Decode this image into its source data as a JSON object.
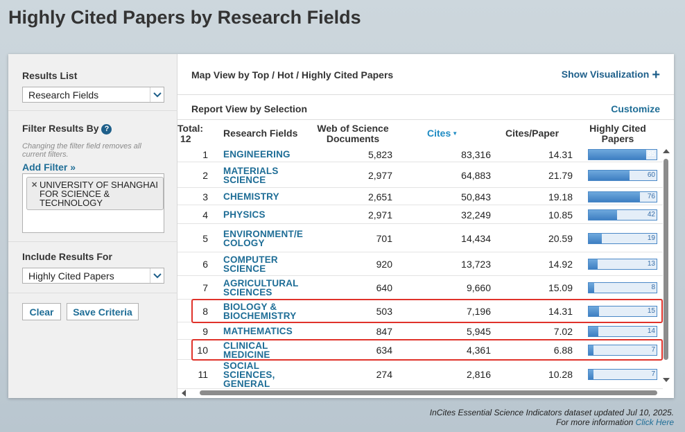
{
  "page_title": "Highly Cited Papers by Research Fields",
  "sidebar": {
    "results_list_heading": "Results List",
    "results_list_value": "Research Fields",
    "filter_heading": "Filter Results By",
    "filter_help": "?",
    "filter_hint": "Changing the filter field removes all current filters.",
    "add_filter": "Add Filter »",
    "filter_chip": "UNIVERSITY OF SHANGHAI FOR SCIENCE & TECHNOLOGY",
    "include_heading": "Include Results For",
    "include_value": "Highly Cited Papers",
    "clear_button": "Clear",
    "save_button": "Save Criteria"
  },
  "main": {
    "map_title": "Map View by Top / Hot / Highly Cited Papers",
    "show_visualization": "Show Visualization",
    "report_title": "Report View by Selection",
    "customize": "Customize"
  },
  "table": {
    "headers": {
      "total": "Total:",
      "total_count": "12",
      "field": "Research Fields",
      "docs": "Web of Science Documents",
      "cites": "Cites",
      "cites_per_paper": "Cites/Paper",
      "highly_cited": "Highly Cited Papers"
    },
    "rows": [
      {
        "rank": "1",
        "field": "ENGINEERING",
        "docs": "5,823",
        "cites": "83,316",
        "cpp": "14.31",
        "hcp": "85",
        "hcp_value": 85
      },
      {
        "rank": "2",
        "field": "MATERIALS SCIENCE",
        "docs": "2,977",
        "cites": "64,883",
        "cpp": "21.79",
        "hcp": "60",
        "hcp_value": 60
      },
      {
        "rank": "3",
        "field": "CHEMISTRY",
        "docs": "2,651",
        "cites": "50,843",
        "cpp": "19.18",
        "hcp": "76",
        "hcp_value": 76
      },
      {
        "rank": "4",
        "field": "PHYSICS",
        "docs": "2,971",
        "cites": "32,249",
        "cpp": "10.85",
        "hcp": "42",
        "hcp_value": 42
      },
      {
        "rank": "5",
        "field": "ENVIRONMENT/E COLOGY",
        "docs": "701",
        "cites": "14,434",
        "cpp": "20.59",
        "hcp": "19",
        "hcp_value": 19
      },
      {
        "rank": "6",
        "field": "COMPUTER SCIENCE",
        "docs": "920",
        "cites": "13,723",
        "cpp": "14.92",
        "hcp": "13",
        "hcp_value": 13
      },
      {
        "rank": "7",
        "field": "AGRICULTURAL SCIENCES",
        "docs": "640",
        "cites": "9,660",
        "cpp": "15.09",
        "hcp": "8",
        "hcp_value": 8
      },
      {
        "rank": "8",
        "field": "BIOLOGY & BIOCHEMISTRY",
        "docs": "503",
        "cites": "7,196",
        "cpp": "14.31",
        "hcp": "15",
        "hcp_value": 15
      },
      {
        "rank": "9",
        "field": "MATHEMATICS",
        "docs": "847",
        "cites": "5,945",
        "cpp": "7.02",
        "hcp": "14",
        "hcp_value": 14
      },
      {
        "rank": "10",
        "field": "CLINICAL MEDICINE",
        "docs": "634",
        "cites": "4,361",
        "cpp": "6.88",
        "hcp": "7",
        "hcp_value": 7
      },
      {
        "rank": "11",
        "field": "SOCIAL SCIENCES, GENERAL",
        "docs": "274",
        "cites": "2,816",
        "cpp": "10.28",
        "hcp": "7",
        "hcp_value": 7
      }
    ]
  },
  "footer": {
    "line1": "InCites Essential Science Indicators dataset updated Jul 10, 2025.",
    "line2_prefix": "For more information",
    "line2_link": "Click Here"
  },
  "colors": {
    "link": "#1e6d96",
    "highlight": "#e0322a",
    "bar": "#4a88c7"
  }
}
